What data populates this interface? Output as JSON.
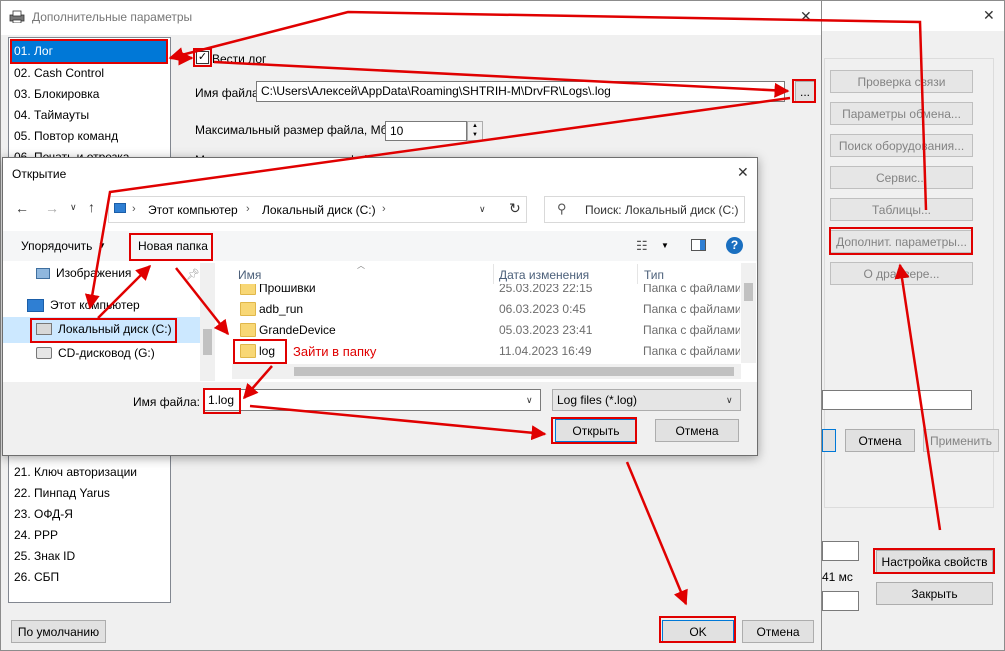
{
  "back_window": {
    "buttons": {
      "check_connection": "Проверка связи",
      "exchange_params": "Параметры обмена...",
      "find_equipment": "Поиск оборудования...",
      "service": "Сервис...",
      "tables": "Таблицы...",
      "extra_params": "Дополнит. параметры...",
      "about_driver": "О драйвере...",
      "cancel": "Отмена",
      "apply": "Применить",
      "property_settings": "Настройка свойств",
      "close": "Закрыть"
    },
    "ms_value": "41 мс"
  },
  "main_dialog": {
    "title": "Дополнительные параметры",
    "close_glyph": "✕",
    "list_items": [
      "01. Лог",
      "02. Cash Control",
      "03. Блокировка",
      "04. Таймауты",
      "05. Повтор команд",
      "06. Печать и отрезка",
      "21. Ключ авторизации",
      "22. Пинпад Yarus",
      "23. ОФД-Я",
      "24. PPP",
      "25. Знак ID",
      "26. СБП"
    ],
    "log_checkbox_label": "Вести лог",
    "filename_label": "Имя файла:",
    "filename_value": "C:\\Users\\Алексей\\AppData\\Roaming\\SHTRIH-M\\DrvFR\\Logs\\.log",
    "browse_label": "...",
    "maxsize_label": "Максимальный размер файла, Мб:",
    "maxsize_value": "10",
    "maxcount_label": "Максимальное количество файлов:",
    "default_button": "По умолчанию",
    "ok_button": "OK",
    "cancel_button": "Отмена"
  },
  "open_dialog": {
    "title": "Открытие",
    "close_glyph": "✕",
    "breadcrumb": [
      "Этот компьютер",
      "Локальный диск (C:)"
    ],
    "search_placeholder": "Поиск: Локальный диск (C:)",
    "organize": "Упорядочить",
    "new_folder": "Новая папка",
    "tree": [
      "Изображения",
      "Этот компьютер",
      "Локальный диск (C:)",
      "CD-дисковод (G:)"
    ],
    "columns": {
      "name": "Имя",
      "date": "Дата изменения",
      "type": "Тип"
    },
    "files": [
      {
        "name": "Прошивки",
        "date": "25.03.2023 22:15",
        "type": "Папка с файлами"
      },
      {
        "name": "adb_run",
        "date": "06.03.2023 0:45",
        "type": "Папка с файлами"
      },
      {
        "name": "GrandeDevice",
        "date": "05.03.2023 23:41",
        "type": "Папка с файлами"
      },
      {
        "name": "log",
        "date": "11.04.2023 16:49",
        "type": "Папка с файлами"
      }
    ],
    "annotation": "Зайти в папку",
    "filename_label": "Имя файла:",
    "filename_value": "1.log",
    "filter_value": "Log files (*.log)",
    "open_button": "Открыть",
    "cancel_button": "Отмена"
  },
  "colors": {
    "annotation_red": "#e00000",
    "accent_blue": "#0078d7",
    "help_blue": "#1a6fc0"
  }
}
